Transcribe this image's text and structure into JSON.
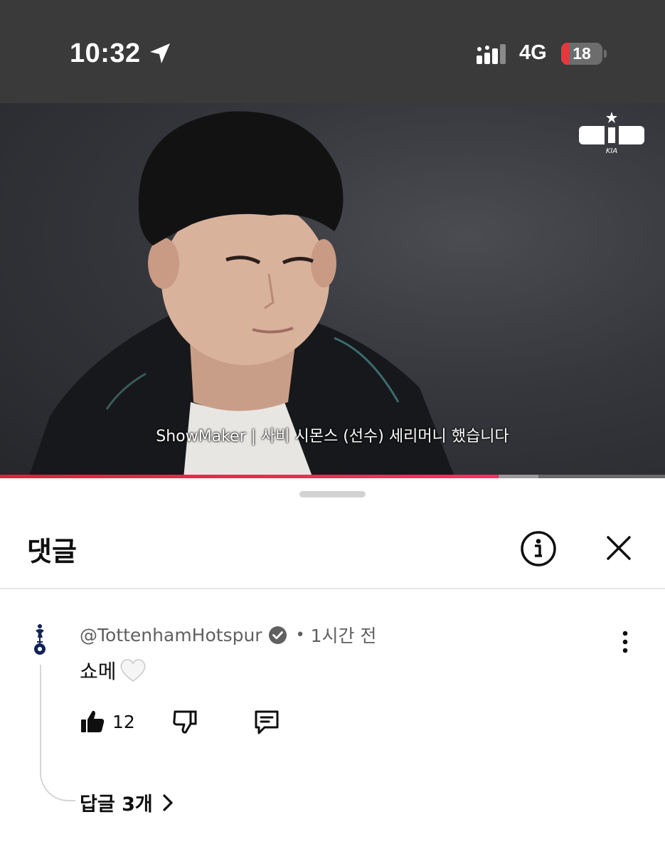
{
  "status_bar": {
    "time": "10:32",
    "location_icon": "location-arrow-icon",
    "signal_icon": "cellular-signal-icon",
    "network": "4G",
    "battery": "18",
    "battery_color": "#e5383b"
  },
  "video": {
    "caption": "ShowMaker | 사비 시몬스 (선수) 세리머니 했습니다",
    "watermark_icon": "kia-team-logo-icon",
    "progress_played": 0.75,
    "progress_buffered": 0.81,
    "progress_color": "#e0213a"
  },
  "comments_sheet": {
    "title": "댓글",
    "info_icon": "info-icon",
    "close_icon": "close-icon",
    "comment": {
      "author": "@TottenhamHotspur",
      "verified_icon": "verified-check-icon",
      "separator": "•",
      "age": "1시간 전",
      "text": "쇼메",
      "emoji_icon": "white-heart-icon",
      "like_count": "12",
      "more_icon": "more-vertical-icon",
      "replies_label": "답글 3개"
    }
  }
}
